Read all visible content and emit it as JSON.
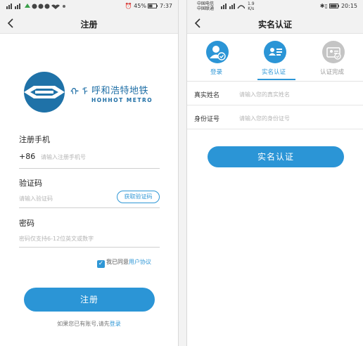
{
  "left": {
    "status": {
      "left": "    ",
      "battery": "45%",
      "time": "7:37"
    },
    "nav_title": "注册",
    "logo": {
      "cn": "呼和浩特地铁",
      "en": "HOHHOT METRO"
    },
    "phone": {
      "label": "注册手机",
      "prefix": "+86",
      "placeholder": "请输入注册手机号"
    },
    "code": {
      "label": "验证码",
      "placeholder": "请输入验证码",
      "button": "获取验证码"
    },
    "password": {
      "label": "密码",
      "placeholder": "密码仅支持6-12位英文或数字"
    },
    "agreement": {
      "checked": true,
      "text": "我已同意",
      "link": "用户协议"
    },
    "submit_label": "注册",
    "footer": {
      "text": "如果您已有账号,请先",
      "link": "登录"
    }
  },
  "right": {
    "status": {
      "carrier1": "中国电信",
      "carrier2": "中国联通",
      "speed": "1.9",
      "speed_unit": "K/s",
      "time": "20:15"
    },
    "nav_title": "实名认证",
    "steps": [
      {
        "label": "登录",
        "state": "done"
      },
      {
        "label": "实名认证",
        "state": "active"
      },
      {
        "label": "认证完成",
        "state": "pending"
      }
    ],
    "name": {
      "label": "真实姓名",
      "placeholder": "请输入您的真实姓名"
    },
    "id": {
      "label": "身份证号",
      "placeholder": "请输入您的身份证号"
    },
    "submit_label": "实名认证"
  },
  "colors": {
    "accent": "#2b95d6",
    "nav_bg": "#f2f2f2",
    "inactive": "#b9b9b9"
  },
  "icons": [
    "back-arrow-icon",
    "checkbox-icon",
    "user-check-icon",
    "id-card-icon",
    "certified-card-icon",
    "logo-icon"
  ]
}
